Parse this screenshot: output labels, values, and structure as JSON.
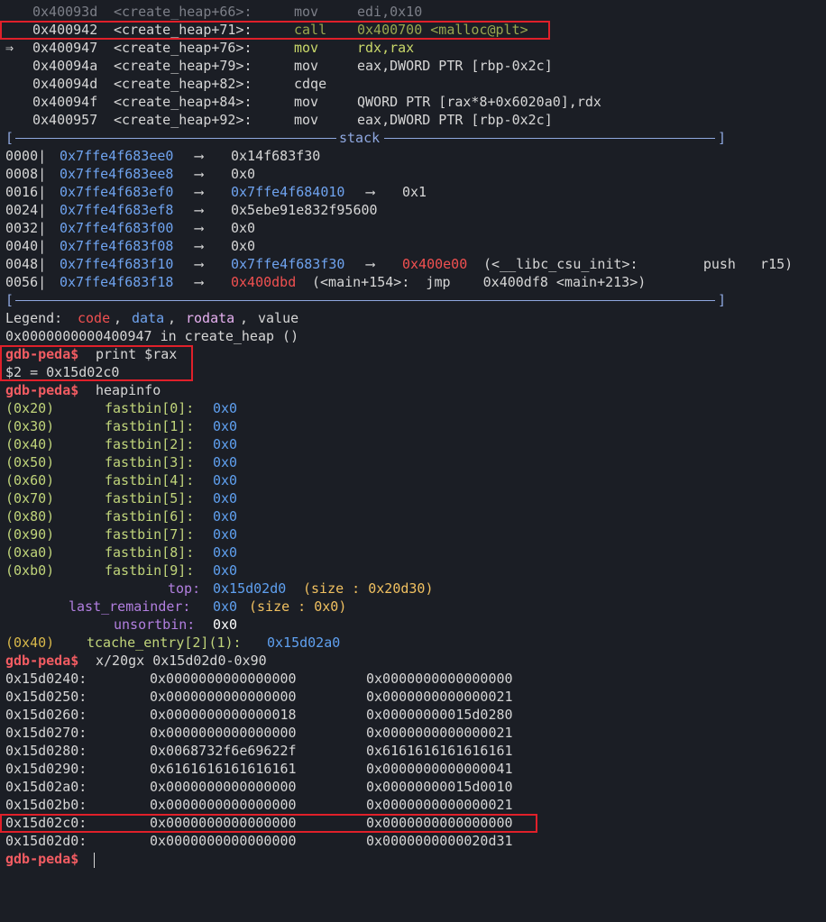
{
  "disasm": [
    {
      "marker": "",
      "addr": "0x40093d",
      "sym": "<create_heap+66>:",
      "op": "mov",
      "args": "edi,0x10",
      "style": "dim"
    },
    {
      "marker": "",
      "addr": "0x400942",
      "sym": "<create_heap+71>:",
      "op": "call",
      "args": "0x400700 <malloc@plt>",
      "style": "call"
    },
    {
      "marker": "⇒",
      "addr": "0x400947",
      "sym": "<create_heap+76>:",
      "op": "mov",
      "args": "rdx,rax",
      "style": "cur"
    },
    {
      "marker": "",
      "addr": "0x40094a",
      "sym": "<create_heap+79>:",
      "op": "mov",
      "args": "eax,DWORD PTR [rbp-0x2c]",
      "style": "norm"
    },
    {
      "marker": "",
      "addr": "0x40094d",
      "sym": "<create_heap+82>:",
      "op": "cdqe",
      "args": "",
      "style": "norm"
    },
    {
      "marker": "",
      "addr": "0x40094f",
      "sym": "<create_heap+84>:",
      "op": "mov",
      "args": "QWORD PTR [rax*8+0x6020a0],rdx",
      "style": "norm"
    },
    {
      "marker": "",
      "addr": "0x400957",
      "sym": "<create_heap+92>:",
      "op": "mov",
      "args": "eax,DWORD PTR [rbp-0x2c]",
      "style": "norm"
    }
  ],
  "stack_header": {
    "left": "[",
    "title": "stack",
    "right": "]"
  },
  "stack": [
    {
      "off": "0000|",
      "addr": "0x7ffe4f683ee0",
      "a1": "⟶",
      "v1": "0x14f683f30",
      "v1c": "val",
      "a2": "",
      "v2": "",
      "v2c": "",
      "tail": ""
    },
    {
      "off": "0008|",
      "addr": "0x7ffe4f683ee8",
      "a1": "⟶",
      "v1": "0x0",
      "v1c": "val",
      "a2": "",
      "v2": "",
      "v2c": "",
      "tail": ""
    },
    {
      "off": "0016|",
      "addr": "0x7ffe4f683ef0",
      "a1": "⟶",
      "v1": "0x7ffe4f684010",
      "v1c": "data",
      "a2": "⟶",
      "v2": "0x1",
      "v2c": "val",
      "tail": ""
    },
    {
      "off": "0024|",
      "addr": "0x7ffe4f683ef8",
      "a1": "⟶",
      "v1": "0x5ebe91e832f95600",
      "v1c": "val",
      "a2": "",
      "v2": "",
      "v2c": "",
      "tail": ""
    },
    {
      "off": "0032|",
      "addr": "0x7ffe4f683f00",
      "a1": "⟶",
      "v1": "0x0",
      "v1c": "val",
      "a2": "",
      "v2": "",
      "v2c": "",
      "tail": ""
    },
    {
      "off": "0040|",
      "addr": "0x7ffe4f683f08",
      "a1": "⟶",
      "v1": "0x0",
      "v1c": "val",
      "a2": "",
      "v2": "",
      "v2c": "",
      "tail": ""
    },
    {
      "off": "0048|",
      "addr": "0x7ffe4f683f10",
      "a1": "⟶",
      "v1": "0x7ffe4f683f30",
      "v1c": "data",
      "a2": "⟶",
      "v2": "0x400e00",
      "v2c": "code",
      "tail": "(<__libc_csu_init>:        push   r15)"
    },
    {
      "off": "0056|",
      "addr": "0x7ffe4f683f18",
      "a1": "⟶",
      "v1": "0x400dbd",
      "v1c": "code",
      "a2": "",
      "v2": "",
      "v2c": "",
      "tail": "(<main+154>:  jmp    0x400df8 <main+213>)"
    }
  ],
  "stack_footer": {
    "left": "[",
    "right": "]"
  },
  "legend": {
    "label": "Legend:",
    "code": "code",
    "data": "data",
    "rodata": "rodata",
    "value": "value",
    "sep": ",",
    "sep2": ","
  },
  "location_line": "0x0000000000400947 in create_heap ()",
  "prompt": "gdb-peda$",
  "cmd_print": "print $rax",
  "print_result": "$2 = 0x15d02c0",
  "cmd_heapinfo": "heapinfo",
  "fastbins": [
    {
      "size": "(0x20)",
      "name": "fastbin[0]:",
      "val": "0x0"
    },
    {
      "size": "(0x30)",
      "name": "fastbin[1]:",
      "val": "0x0"
    },
    {
      "size": "(0x40)",
      "name": "fastbin[2]:",
      "val": "0x0"
    },
    {
      "size": "(0x50)",
      "name": "fastbin[3]:",
      "val": "0x0"
    },
    {
      "size": "(0x60)",
      "name": "fastbin[4]:",
      "val": "0x0"
    },
    {
      "size": "(0x70)",
      "name": "fastbin[5]:",
      "val": "0x0"
    },
    {
      "size": "(0x80)",
      "name": "fastbin[6]:",
      "val": "0x0"
    },
    {
      "size": "(0x90)",
      "name": "fastbin[7]:",
      "val": "0x0"
    },
    {
      "size": "(0xa0)",
      "name": "fastbin[8]:",
      "val": "0x0"
    },
    {
      "size": "(0xb0)",
      "name": "fastbin[9]:",
      "val": "0x0"
    }
  ],
  "top": {
    "label": "top:",
    "val": "0x15d02d0",
    "size": "(size : 0x20d30)"
  },
  "last_remainder": {
    "label": "last_remainder:",
    "val": "0x0",
    "size": "(size : 0x0)"
  },
  "unsortbin": {
    "label": "unsortbin:",
    "val": "0x0"
  },
  "tcache": {
    "size": "(0x40)",
    "label": "tcache_entry[2](1):",
    "val": "0x15d02a0"
  },
  "cmd_x": "x/20gx 0x15d02d0-0x90",
  "mem": [
    {
      "addr": "0x15d0240:",
      "a": "0x0000000000000000",
      "b": "0x0000000000000000"
    },
    {
      "addr": "0x15d0250:",
      "a": "0x0000000000000000",
      "b": "0x0000000000000021"
    },
    {
      "addr": "0x15d0260:",
      "a": "0x0000000000000018",
      "b": "0x00000000015d0280"
    },
    {
      "addr": "0x15d0270:",
      "a": "0x0000000000000000",
      "b": "0x0000000000000021"
    },
    {
      "addr": "0x15d0280:",
      "a": "0x0068732f6e69622f",
      "b": "0x6161616161616161"
    },
    {
      "addr": "0x15d0290:",
      "a": "0x6161616161616161",
      "b": "0x0000000000000041"
    },
    {
      "addr": "0x15d02a0:",
      "a": "0x0000000000000000",
      "b": "0x00000000015d0010"
    },
    {
      "addr": "0x15d02b0:",
      "a": "0x0000000000000000",
      "b": "0x0000000000000021"
    },
    {
      "addr": "0x15d02c0:",
      "a": "0x0000000000000000",
      "b": "0x0000000000000000"
    },
    {
      "addr": "0x15d02d0:",
      "a": "0x0000000000000000",
      "b": "0x0000000000020d31"
    }
  ],
  "colors": {
    "background": "#1b1e25",
    "prompt": "#f25c62",
    "highlight_box": "#e0202a",
    "data": "#6fa3ef",
    "code": "#f05050",
    "bins": "#c0d47a",
    "opcode": "#a9b665"
  }
}
